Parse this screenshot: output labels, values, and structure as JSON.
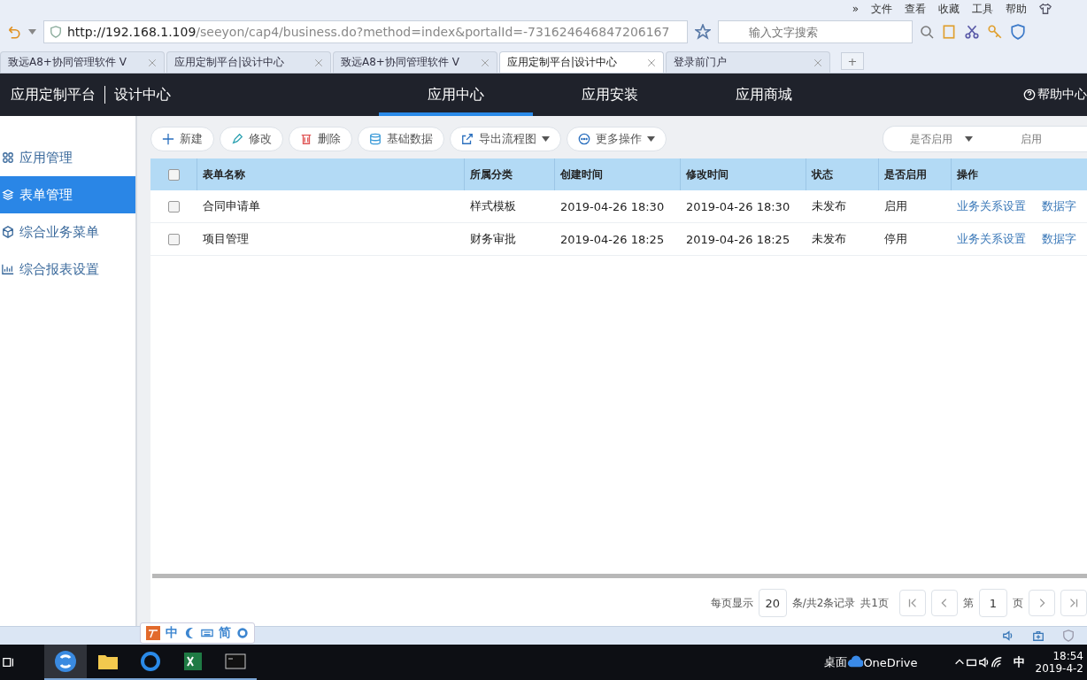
{
  "browser": {
    "more": "»",
    "menu": [
      "文件",
      "查看",
      "收藏",
      "工具",
      "帮助"
    ],
    "url": {
      "host": "http://192.168.1.109",
      "path": "/seeyon/cap4/business.do?method=index&portalId=-731624646847206167"
    },
    "search": {
      "placeholder": "输入文字搜索"
    },
    "tabs": [
      {
        "title": "致远A8+协同管理软件 V",
        "selected": false
      },
      {
        "title": "应用定制平台|设计中心",
        "selected": false
      },
      {
        "title": "致远A8+协同管理软件 V",
        "selected": false
      },
      {
        "title": "应用定制平台|设计中心",
        "selected": true
      },
      {
        "title": "登录前门户",
        "selected": false
      }
    ],
    "new_tab": "+"
  },
  "app": {
    "brand": "应用定制平台",
    "section": "设计中心",
    "nav": [
      {
        "label": "应用中心",
        "selected": true
      },
      {
        "label": "应用安装",
        "selected": false
      },
      {
        "label": "应用商城",
        "selected": false
      }
    ],
    "help": "帮助中心"
  },
  "sidebar": {
    "items": [
      {
        "label": "应用管理",
        "selected": false
      },
      {
        "label": "表单管理",
        "selected": true
      },
      {
        "label": "综合业务菜单",
        "selected": false
      },
      {
        "label": "综合报表设置",
        "selected": false
      }
    ]
  },
  "toolbar": {
    "buttons": [
      {
        "kind": "new",
        "label": "新建",
        "dropdown": false
      },
      {
        "kind": "edit",
        "label": "修改",
        "dropdown": false
      },
      {
        "kind": "delete",
        "label": "删除",
        "dropdown": false
      },
      {
        "kind": "data",
        "label": "基础数据",
        "dropdown": false
      },
      {
        "kind": "export",
        "label": "导出流程图",
        "dropdown": true
      },
      {
        "kind": "more",
        "label": "更多操作",
        "dropdown": true
      }
    ],
    "filter": {
      "field": "是否启用",
      "value": "启用"
    }
  },
  "table": {
    "all_checked": false,
    "columns": [
      "表单名称",
      "所属分类",
      "创建时间",
      "修改时间",
      "状态",
      "是否启用",
      "操作"
    ],
    "rows": [
      {
        "checked": false,
        "cells": [
          "合同申请单",
          "样式模板",
          "2019-04-26 18:30",
          "2019-04-26 18:30",
          "未发布",
          "启用"
        ],
        "actions": [
          "业务关系设置",
          "数据字"
        ]
      },
      {
        "checked": false,
        "cells": [
          "项目管理",
          "财务审批",
          "2019-04-26 18:25",
          "2019-04-26 18:25",
          "未发布",
          "停用"
        ],
        "actions": [
          "业务关系设置",
          "数据字"
        ]
      }
    ]
  },
  "pagination": {
    "per_page_label": "每页显示",
    "per_page": "20",
    "records": "条/共2条记录",
    "pages": "共1页",
    "page_prefix": "第",
    "page": "1",
    "page_suffix": "页"
  },
  "ime": {
    "mode": "中",
    "script": "简"
  },
  "taskbar": {
    "desktop": "桌面",
    "onedrive": "OneDrive",
    "ime": "中",
    "time": "18:54",
    "date": "2019-4-2"
  }
}
